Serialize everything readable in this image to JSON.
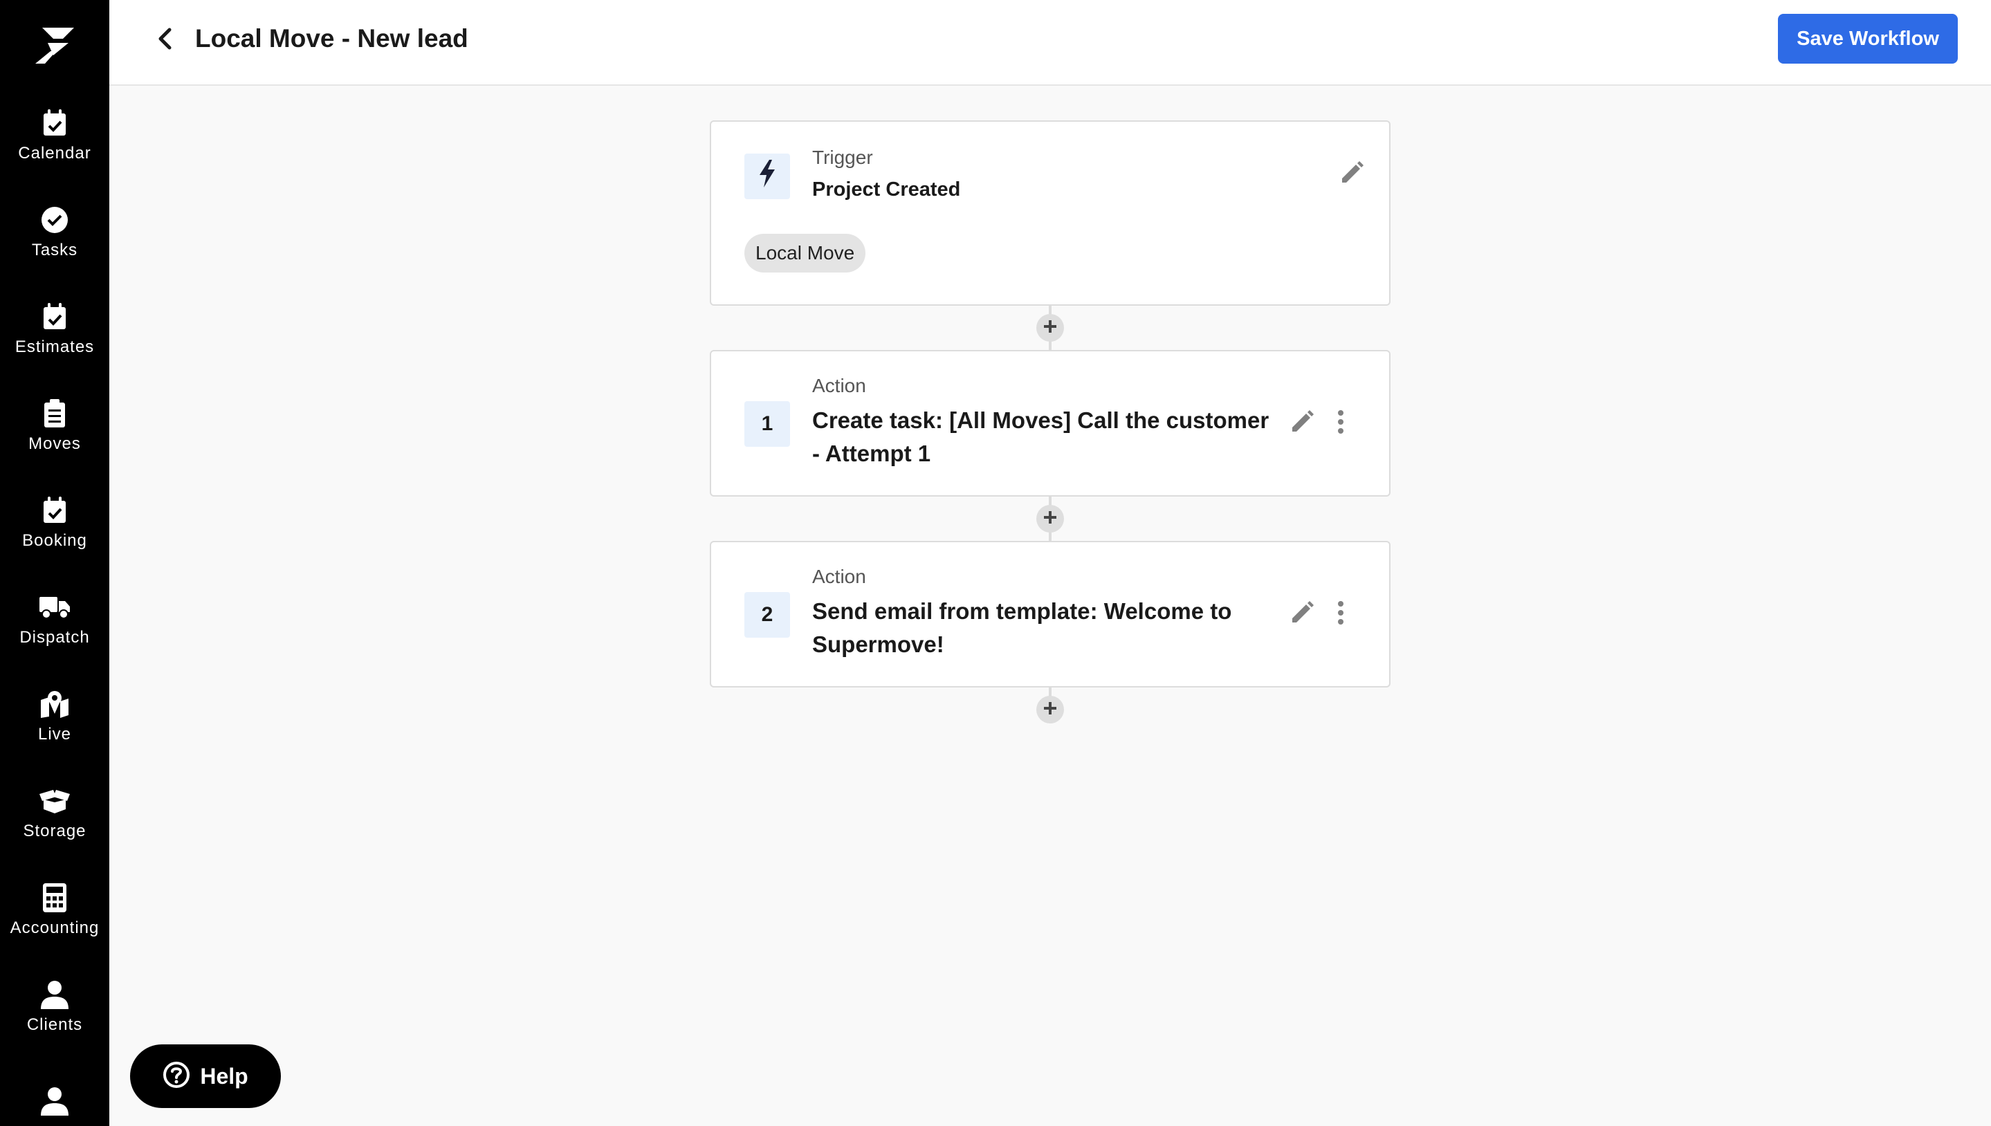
{
  "sidebar": {
    "logo_icon": "supermove-bolt-logo",
    "items": [
      {
        "label": "Calendar",
        "icon": "calendar-check-icon"
      },
      {
        "label": "Tasks",
        "icon": "check-circle-icon"
      },
      {
        "label": "Estimates",
        "icon": "calendar-check-icon"
      },
      {
        "label": "Moves",
        "icon": "clipboard-list-icon"
      },
      {
        "label": "Booking",
        "icon": "calendar-check-icon"
      },
      {
        "label": "Dispatch",
        "icon": "truck-icon"
      },
      {
        "label": "Live",
        "icon": "map-pin-icon"
      },
      {
        "label": "Storage",
        "icon": "box-open-icon"
      },
      {
        "label": "Accounting",
        "icon": "calculator-icon"
      },
      {
        "label": "Clients",
        "icon": "user-icon"
      }
    ]
  },
  "header": {
    "title": "Local Move - New lead",
    "save_label": "Save Workflow"
  },
  "trigger": {
    "kicker": "Trigger",
    "title": "Project Created",
    "tag": "Local Move"
  },
  "actions": [
    {
      "number": "1",
      "kicker": "Action",
      "title": "Create task: [All Moves] Call the customer - Attempt 1"
    },
    {
      "number": "2",
      "kicker": "Action",
      "title": "Send email from template: Welcome to Supermove!"
    }
  ],
  "help": {
    "label": "Help"
  },
  "colors": {
    "accent": "#2e6be6",
    "sidebar_bg": "#000000",
    "badge_bg": "#e8f1fc",
    "page_bg": "#f9f9f9"
  }
}
